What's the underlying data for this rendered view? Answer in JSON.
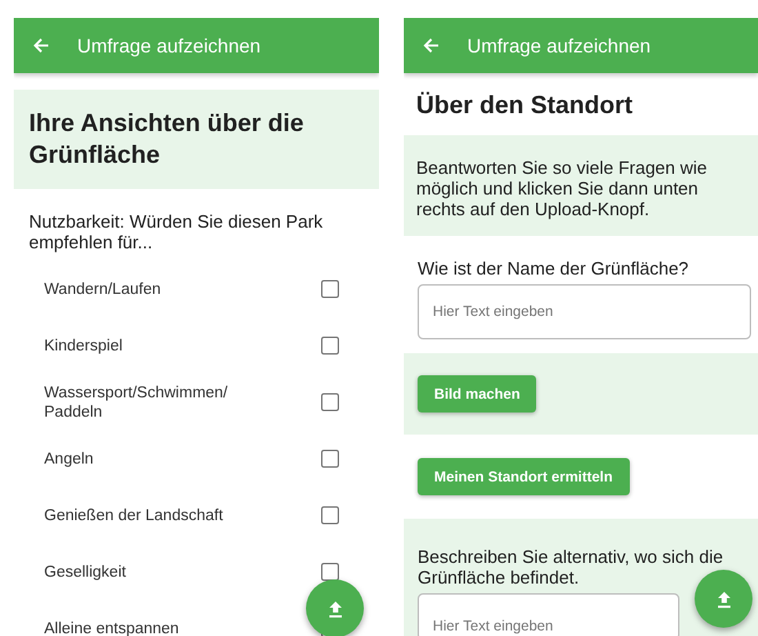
{
  "screens": [
    {
      "app_bar": {
        "title": "Umfrage aufzeichnen"
      },
      "blocks": [
        {
          "kind": "heading",
          "text": "Ihre Ansichten über die Grünfläche",
          "shaded": true
        },
        {
          "kind": "question",
          "text": "Nutzbarkeit: Würden Sie diesen Park empfehlen für...",
          "shaded": false
        },
        {
          "kind": "checklist",
          "shaded": false,
          "items": [
            {
              "label": "Wandern/Laufen",
              "checked": false
            },
            {
              "label": "Kinderspiel",
              "checked": false
            },
            {
              "label": "Wassersport/Schwimmen/ Paddeln",
              "checked": false
            },
            {
              "label": "Angeln",
              "checked": false
            },
            {
              "label": "Genießen der Landschaft",
              "checked": false
            },
            {
              "label": "Geselligkeit",
              "checked": false
            },
            {
              "label": "Alleine entspannen",
              "checked": false
            }
          ]
        }
      ]
    },
    {
      "app_bar": {
        "title": "Umfrage aufzeichnen"
      },
      "blocks": [
        {
          "kind": "heading",
          "text": "Über den Standort",
          "shaded": false
        },
        {
          "kind": "note",
          "text": "Beantworten Sie so viele Fragen wie möglich und klicken Sie dann unten rechts auf den Upload-Knopf.",
          "shaded": true
        },
        {
          "kind": "text_field",
          "label": "Wie ist der Name der Grünfläche?",
          "placeholder": "Hier Text eingeben",
          "shaded": false
        },
        {
          "kind": "button",
          "label": "Bild machen",
          "shaded": true
        },
        {
          "kind": "button",
          "label": "Meinen Standort ermitteln",
          "shaded": false
        },
        {
          "kind": "text_area",
          "label": "Beschreiben Sie alternativ, wo sich die Grünfläche befindet.",
          "placeholder": "Hier Text eingeben",
          "shaded": true
        }
      ]
    }
  ]
}
